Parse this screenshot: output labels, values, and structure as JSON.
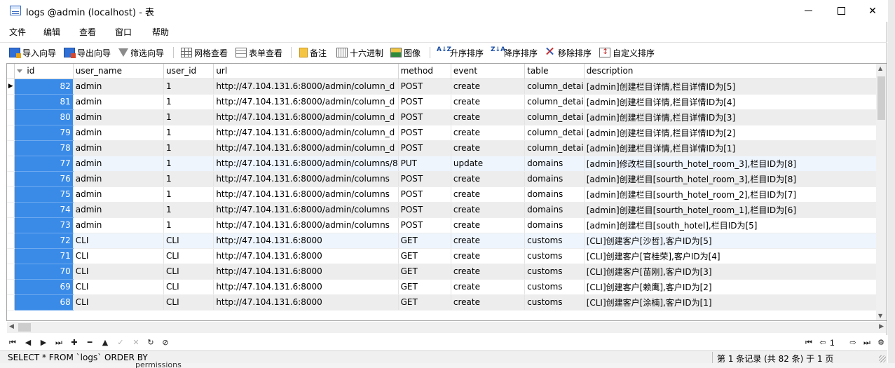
{
  "window": {
    "title": "logs @admin (localhost) - 表",
    "minimize_label": "",
    "close_glyph": "✕"
  },
  "menu": [
    "文件",
    "编辑",
    "查看",
    "窗口",
    "帮助"
  ],
  "toolbar": {
    "import": "导入向导",
    "export": "导出向导",
    "filter": "筛选向导",
    "grid_view": "网格查看",
    "form_view": "表单查看",
    "memo": "备注",
    "hex": "十六进制",
    "image": "图像",
    "sort_asc": "升序排序",
    "sort_desc": "降序排序",
    "remove_sort": "移除排序",
    "custom_sort": "自定义排序",
    "sort_asc_glyph": "A↓Z",
    "sort_desc_glyph": "Z↓A"
  },
  "table": {
    "columns": [
      "id",
      "user_name",
      "user_id",
      "url",
      "method",
      "event",
      "table",
      "description"
    ],
    "rows": [
      [
        "82",
        "admin",
        "1",
        "http://47.104.131.6:8000/admin/column_d",
        "POST",
        "create",
        "column_detai",
        "[admin]创建栏目详情,栏目详情ID为[5]"
      ],
      [
        "81",
        "admin",
        "1",
        "http://47.104.131.6:8000/admin/column_d",
        "POST",
        "create",
        "column_detai",
        "[admin]创建栏目详情,栏目详情ID为[4]"
      ],
      [
        "80",
        "admin",
        "1",
        "http://47.104.131.6:8000/admin/column_d",
        "POST",
        "create",
        "column_detai",
        "[admin]创建栏目详情,栏目详情ID为[3]"
      ],
      [
        "79",
        "admin",
        "1",
        "http://47.104.131.6:8000/admin/column_d",
        "POST",
        "create",
        "column_detai",
        "[admin]创建栏目详情,栏目详情ID为[2]"
      ],
      [
        "78",
        "admin",
        "1",
        "http://47.104.131.6:8000/admin/column_d",
        "POST",
        "create",
        "column_detai",
        "[admin]创建栏目详情,栏目详情ID为[1]"
      ],
      [
        "77",
        "admin",
        "1",
        "http://47.104.131.6:8000/admin/columns/8",
        "PUT",
        "update",
        "domains",
        "[admin]修改栏目[sourth_hotel_room_3],栏目ID为[8]"
      ],
      [
        "76",
        "admin",
        "1",
        "http://47.104.131.6:8000/admin/columns",
        "POST",
        "create",
        "domains",
        "[admin]创建栏目[sourth_hotel_room_3],栏目ID为[8]"
      ],
      [
        "75",
        "admin",
        "1",
        "http://47.104.131.6:8000/admin/columns",
        "POST",
        "create",
        "domains",
        "[admin]创建栏目[sourth_hotel_room_2],栏目ID为[7]"
      ],
      [
        "74",
        "admin",
        "1",
        "http://47.104.131.6:8000/admin/columns",
        "POST",
        "create",
        "domains",
        "[admin]创建栏目[sourth_hotel_room_1],栏目ID为[6]"
      ],
      [
        "73",
        "admin",
        "1",
        "http://47.104.131.6:8000/admin/columns",
        "POST",
        "create",
        "domains",
        "[admin]创建栏目[south_hotel],栏目ID为[5]"
      ],
      [
        "72",
        "CLI",
        "CLI",
        "http://47.104.131.6:8000",
        "GET",
        "create",
        "customs",
        "[CLI]创建客户[沙哲],客户ID为[5]"
      ],
      [
        "71",
        "CLI",
        "CLI",
        "http://47.104.131.6:8000",
        "GET",
        "create",
        "customs",
        "[CLI]创建客户[官桂荣],客户ID为[4]"
      ],
      [
        "70",
        "CLI",
        "CLI",
        "http://47.104.131.6:8000",
        "GET",
        "create",
        "customs",
        "[CLI]创建客户[苗刚],客户ID为[3]"
      ],
      [
        "69",
        "CLI",
        "CLI",
        "http://47.104.131.6:8000",
        "GET",
        "create",
        "customs",
        "[CLI]创建客户[赖鹰],客户ID为[2]"
      ],
      [
        "68",
        "CLI",
        "CLI",
        "http://47.104.131.6:8000",
        "GET",
        "create",
        "customs",
        "[CLI]创建客户[涂楠],客户ID为[1]"
      ]
    ],
    "current_row_marker": "▶"
  },
  "navigation": {
    "first": "⏮",
    "prev": "◀",
    "next": "▶",
    "last": "⏭",
    "add": "✚",
    "delete": "━",
    "up": "▲",
    "apply": "✓",
    "cancel": "✕",
    "refresh": "↻",
    "stop": "⊘",
    "page_first": "⏮",
    "page_prev": "⇦",
    "page_value": "1",
    "page_next": "⇨",
    "page_last": "⏭",
    "settings": "⚙"
  },
  "status": {
    "sql": "SELECT * FROM `logs` ORDER BY",
    "record_info": "第 1 条记录 (共 82 条) 于 1 页"
  },
  "background": {
    "partial_label": "permissions"
  }
}
